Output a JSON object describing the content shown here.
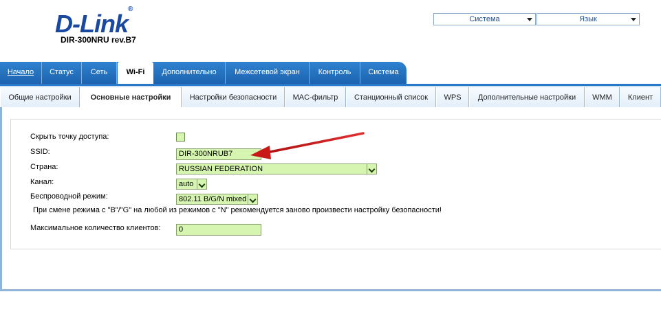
{
  "brand": {
    "logo": "D-Link",
    "reg": "®",
    "model": "DIR-300NRU rev.B7"
  },
  "top_selects": {
    "system": "Система",
    "language": "Язык"
  },
  "main_tabs": [
    "Начало",
    "Статус",
    "Сеть",
    "Wi-Fi",
    "Дополнительно",
    "Межсетевой экран",
    "Контроль",
    "Система"
  ],
  "sub_tabs": [
    "Общие настройки",
    "Основные настройки",
    "Настройки безопасности",
    "MAC-фильтр",
    "Станционный список",
    "WPS",
    "Дополнительные настройки",
    "WMM",
    "Клиент"
  ],
  "form": {
    "hide_ap_label": "Скрыть точку доступа:",
    "ssid_label": "SSID:",
    "ssid_value": "DIR-300NRUB7",
    "country_label": "Страна:",
    "country_value": "RUSSIAN FEDERATION",
    "channel_label": "Канал:",
    "channel_value": "auto",
    "mode_label": "Беспроводной режим:",
    "mode_value": "802.11 B/G/N mixed",
    "mode_note": "При смене режима с \"B\"/\"G\" на любой из режимов с \"N\" рекомендуется заново произвести настройку безопасности!",
    "max_clients_label": "Максимальное количество клиентов:",
    "max_clients_value": "0"
  },
  "colors": {
    "tab_bar": "#1f6bb8",
    "field_bg": "#d6f5b0",
    "arrow": "#d42020",
    "logo": "#1a4aa0"
  }
}
